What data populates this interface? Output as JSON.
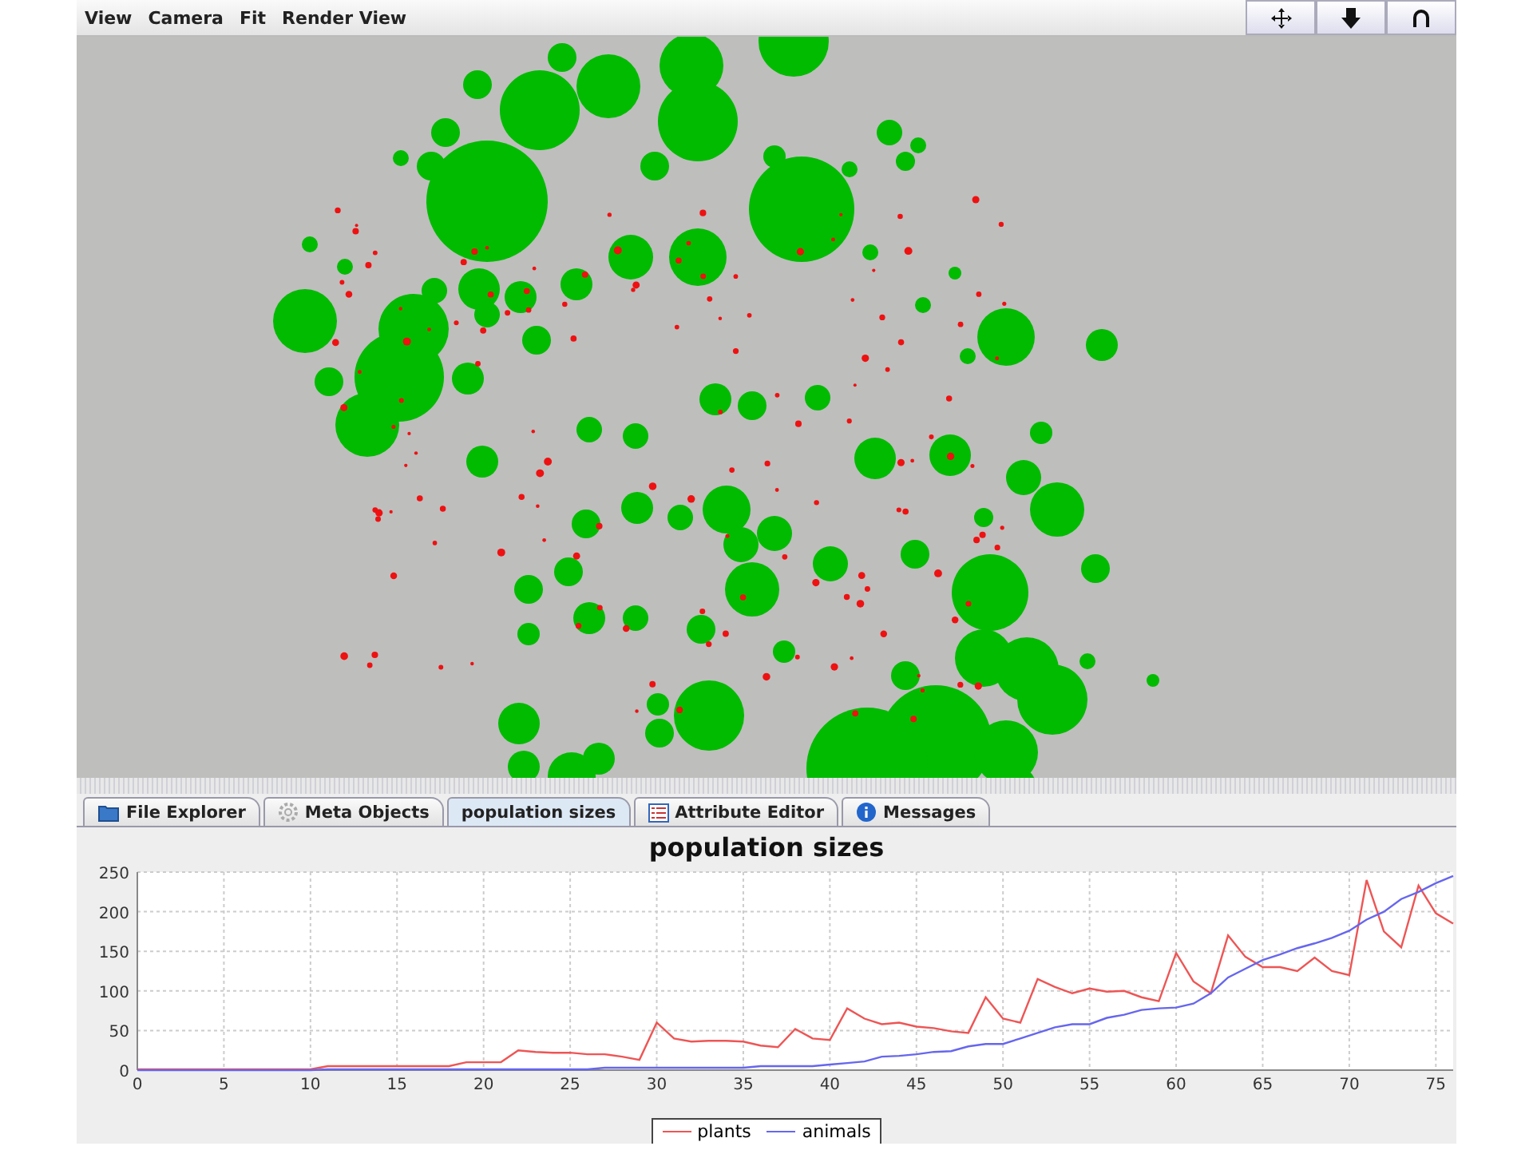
{
  "menu": [
    {
      "label": "View"
    },
    {
      "label": "Camera"
    },
    {
      "label": "Fit"
    },
    {
      "label": "Render View"
    }
  ],
  "tabs": [
    {
      "label": "File Explorer",
      "kind": "folder",
      "selected": false
    },
    {
      "label": "Meta Objects",
      "kind": "gear",
      "selected": false
    },
    {
      "label": "population sizes",
      "kind": "plain",
      "selected": true
    },
    {
      "label": "Attribute Editor",
      "kind": "table",
      "selected": false
    },
    {
      "label": "Messages",
      "kind": "info",
      "selected": false
    }
  ],
  "chart": {
    "chart_data": {
      "type": "line",
      "title": "population sizes",
      "x": [
        0,
        1,
        2,
        3,
        4,
        5,
        6,
        7,
        8,
        9,
        10,
        11,
        12,
        13,
        14,
        15,
        16,
        17,
        18,
        19,
        20,
        21,
        22,
        23,
        24,
        25,
        26,
        27,
        28,
        29,
        30,
        31,
        32,
        33,
        34,
        35,
        36,
        37,
        38,
        39,
        40,
        41,
        42,
        43,
        44,
        45,
        46,
        47,
        48,
        49,
        50,
        51,
        52,
        53,
        54,
        55,
        56,
        57,
        58,
        59,
        60,
        61,
        62,
        63,
        64,
        65,
        66,
        67,
        68,
        69,
        70,
        71,
        72,
        73,
        74,
        75,
        76
      ],
      "series": [
        {
          "name": "plants",
          "color": "#ee5555",
          "values": [
            1,
            1,
            1,
            1,
            1,
            1,
            1,
            1,
            1,
            1,
            1,
            5,
            5,
            5,
            5,
            5,
            5,
            5,
            5,
            10,
            10,
            10,
            25,
            23,
            22,
            22,
            20,
            20,
            17,
            13,
            60,
            40,
            36,
            37,
            37,
            36,
            31,
            29,
            52,
            40,
            38,
            78,
            65,
            58,
            60,
            55,
            53,
            49,
            47,
            92,
            65,
            60,
            115,
            105,
            97,
            103,
            99,
            100,
            92,
            87,
            148,
            112,
            97,
            170,
            143,
            130,
            130,
            125,
            142,
            125,
            120,
            240,
            175,
            155,
            233,
            198,
            185
          ]
        },
        {
          "name": "animals",
          "color": "#6666ee",
          "values": [
            0,
            0,
            0,
            0,
            0,
            0,
            0,
            0,
            0,
            0,
            0,
            1,
            1,
            1,
            1,
            1,
            1,
            1,
            1,
            1,
            1,
            1,
            1,
            1,
            1,
            1,
            1,
            3,
            3,
            3,
            3,
            3,
            3,
            3,
            3,
            3,
            5,
            5,
            5,
            5,
            7,
            9,
            11,
            17,
            18,
            20,
            23,
            24,
            30,
            33,
            33,
            40,
            47,
            54,
            58,
            58,
            66,
            70,
            76,
            78,
            79,
            84,
            97,
            117,
            128,
            139,
            146,
            154,
            160,
            167,
            176,
            190,
            200,
            216,
            225,
            236,
            245
          ]
        }
      ],
      "xlim": [
        0,
        76
      ],
      "ylim": [
        0,
        250
      ],
      "xticks": [
        0,
        5,
        10,
        15,
        20,
        25,
        30,
        35,
        40,
        45,
        50,
        55,
        60,
        65,
        70,
        75
      ],
      "yticks": [
        0,
        50,
        100,
        150,
        200,
        250
      ],
      "grid": true
    }
  }
}
